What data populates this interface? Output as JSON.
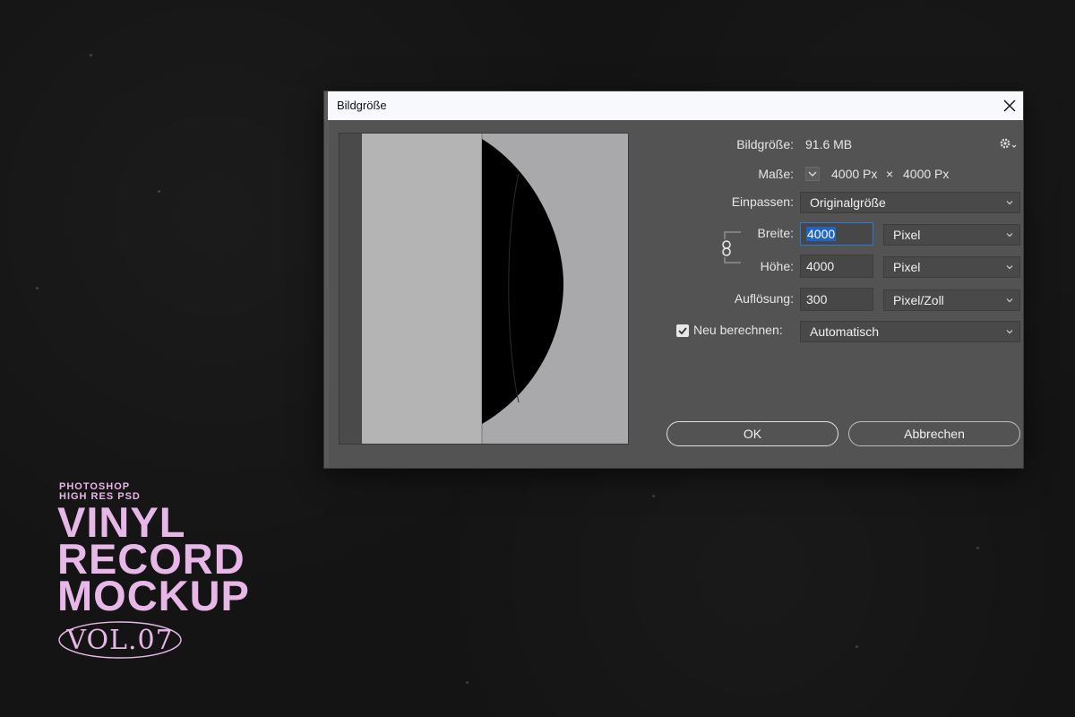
{
  "dialog": {
    "title": "Bildgröße",
    "image_size": {
      "label": "Bildgröße:",
      "value": "91.6 MB"
    },
    "dimensions": {
      "label": "Maße:",
      "width": "4000 Px",
      "times": "×",
      "height": "4000 Px"
    },
    "fit": {
      "label": "Einpassen:",
      "value": "Originalgröße"
    },
    "width": {
      "label": "Breite:",
      "value": "4000",
      "unit": "Pixel"
    },
    "height": {
      "label": "Höhe:",
      "value": "4000",
      "unit": "Pixel"
    },
    "resolution": {
      "label": "Auflösung:",
      "value": "300",
      "unit": "Pixel/Zoll"
    },
    "resample": {
      "label": "Neu berechnen:",
      "checked": true,
      "value": "Automatisch"
    },
    "ok_label": "OK",
    "cancel_label": "Abbrechen"
  },
  "brand": {
    "line1": "PHOTOSHOP",
    "line2": "HIGH RES PSD",
    "title1": "VINYL",
    "title2": "RECORD",
    "title3": "MOCKUP",
    "volume": "VOL.07",
    "accent_color": "#e7b7e8"
  },
  "icons": [
    "close-icon",
    "gear-icon",
    "chevron-down-icon",
    "link-chain-icon",
    "checkbox-checked-icon"
  ]
}
